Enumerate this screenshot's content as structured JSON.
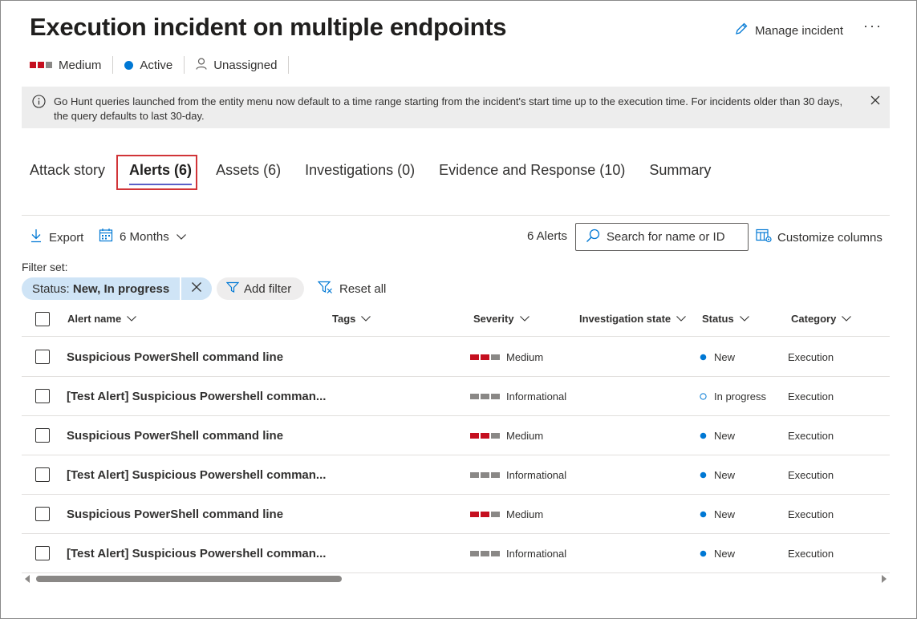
{
  "title": "Execution incident on multiple endpoints",
  "header": {
    "manage_label": "Manage incident",
    "more_label": "···"
  },
  "meta": {
    "severity": "Medium",
    "status": "Active",
    "assignee": "Unassigned"
  },
  "banner": {
    "text": "Go Hunt queries launched from the entity menu now default to a time range starting from the incident's start time up to the execution time. For incidents older than 30 days, the query defaults to last 30-day."
  },
  "tabs": [
    {
      "label": "Attack story"
    },
    {
      "label": "Alerts (6)"
    },
    {
      "label": "Assets (6)"
    },
    {
      "label": "Investigations (0)"
    },
    {
      "label": "Evidence and Response (10)"
    },
    {
      "label": "Summary"
    }
  ],
  "toolbar": {
    "export_label": "Export",
    "range_label": "6 Months",
    "count_label": "6 Alerts",
    "search_placeholder": "Search for name or ID",
    "customize_label": "Customize columns"
  },
  "filters": {
    "set_label": "Filter set:",
    "pill_key": "Status:",
    "pill_value": "New, In progress",
    "add_label": "Add filter",
    "reset_label": "Reset all"
  },
  "columns": {
    "alert_name": "Alert name",
    "tags": "Tags",
    "severity": "Severity",
    "investigation": "Investigation state",
    "status": "Status",
    "category": "Category"
  },
  "rows": [
    {
      "name": "Suspicious PowerShell command line",
      "severity": "Medium",
      "status": "New",
      "category": "Execution"
    },
    {
      "name": "[Test Alert] Suspicious Powershell comman...",
      "severity": "Informational",
      "status": "In progress",
      "category": "Execution"
    },
    {
      "name": "Suspicious PowerShell command line",
      "severity": "Medium",
      "status": "New",
      "category": "Execution"
    },
    {
      "name": "[Test Alert] Suspicious Powershell comman...",
      "severity": "Informational",
      "status": "New",
      "category": "Execution"
    },
    {
      "name": "Suspicious PowerShell command line",
      "severity": "Medium",
      "status": "New",
      "category": "Execution"
    },
    {
      "name": "[Test Alert] Suspicious Powershell comman...",
      "severity": "Informational",
      "status": "New",
      "category": "Execution"
    }
  ],
  "colors": {
    "medium": "#c50f1f",
    "neutral": "#8a8886",
    "accent": "#0078d4",
    "selected_tab_box": "#d13438"
  },
  "icons": [
    "edit-icon",
    "info-icon",
    "close-icon",
    "download-icon",
    "calendar-icon",
    "chevron-down-icon",
    "search-icon",
    "columns-icon",
    "filter-icon",
    "reset-filter-icon",
    "person-icon"
  ]
}
